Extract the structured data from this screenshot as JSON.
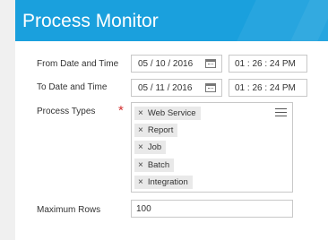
{
  "header": {
    "title": "Process Monitor"
  },
  "form": {
    "from_label": "From Date and Time",
    "from_date": "05 / 10 / 2016",
    "from_time": "01 : 26 : 24  PM",
    "to_label": "To Date and Time",
    "to_date": "05 / 11 / 2016",
    "to_time": "01 : 26 : 24  PM",
    "process_types_label": "Process Types",
    "required_marker": "*",
    "process_types": [
      {
        "label": "Web Service"
      },
      {
        "label": "Report"
      },
      {
        "label": "Job"
      },
      {
        "label": "Batch"
      },
      {
        "label": "Integration"
      }
    ],
    "remove_glyph": "×",
    "max_rows_label": "Maximum Rows",
    "max_rows_value": "100"
  },
  "colors": {
    "header_bg": "#1aa0dd",
    "required": "#d32f2f",
    "tag_bg": "#e9e9e9"
  },
  "icons": {
    "calendar": "calendar-icon",
    "list": "list-icon",
    "remove": "remove-icon"
  }
}
